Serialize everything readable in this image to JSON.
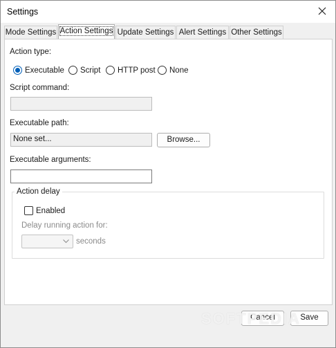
{
  "window": {
    "title": "Settings"
  },
  "tabs": [
    {
      "label": "Mode Settings",
      "active": false
    },
    {
      "label": "Action Settings",
      "active": true
    },
    {
      "label": "Update Settings",
      "active": false
    },
    {
      "label": "Alert Settings",
      "active": false
    },
    {
      "label": "Other Settings",
      "active": false
    }
  ],
  "action": {
    "type_label": "Action type:",
    "options": [
      {
        "label": "Executable",
        "selected": true
      },
      {
        "label": "Script",
        "selected": false
      },
      {
        "label": "HTTP post",
        "selected": false
      },
      {
        "label": "None",
        "selected": false
      }
    ],
    "script_command_label": "Script command:",
    "script_command_value": "",
    "executable_path_label": "Executable path:",
    "executable_path_value": "None set...",
    "browse_label": "Browse...",
    "executable_args_label": "Executable arguments:",
    "executable_args_value": ""
  },
  "delay": {
    "group_title": "Action delay",
    "enabled_label": "Enabled",
    "enabled_checked": false,
    "delay_label": "Delay running action for:",
    "selected_value": "",
    "unit": "seconds"
  },
  "footer": {
    "cancel_label": "Cancel",
    "save_label": "Save"
  },
  "watermark": "SOFTPEDIA",
  "icons": {
    "close": "close-icon",
    "dropdown": "chevron-down-icon"
  },
  "colors": {
    "accent": "#005fb8",
    "panel": "#ffffff",
    "window": "#f0f0f0"
  }
}
